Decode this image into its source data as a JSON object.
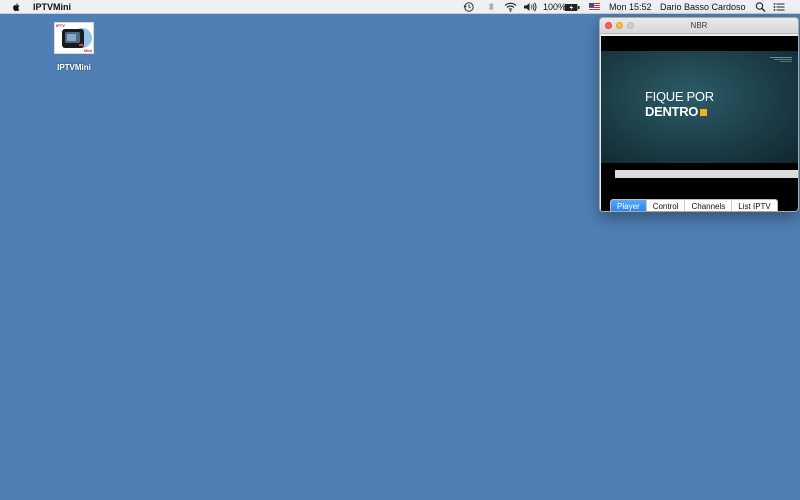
{
  "menubar": {
    "app_name": "IPTVMini",
    "battery": "100%",
    "clock": "Mon 15:52",
    "user": "Dario Basso Cardoso"
  },
  "desktop": {
    "icon_label": "IPTVMini",
    "icon_text_top": "IPTV",
    "icon_text_bottom": "Mini"
  },
  "window": {
    "title": "NBR",
    "video": {
      "promo_line1": "FIQUE POR",
      "promo_line2": "DENTRO"
    },
    "tabs": [
      {
        "label": "Player",
        "active": true
      },
      {
        "label": "Control",
        "active": false
      },
      {
        "label": "Channels",
        "active": false
      },
      {
        "label": "List IPTV",
        "active": false
      }
    ]
  },
  "colors": {
    "desktop_bg": "#4f7fb5",
    "accent": "#1f7ff0",
    "promo_square": "#f4b01c"
  }
}
